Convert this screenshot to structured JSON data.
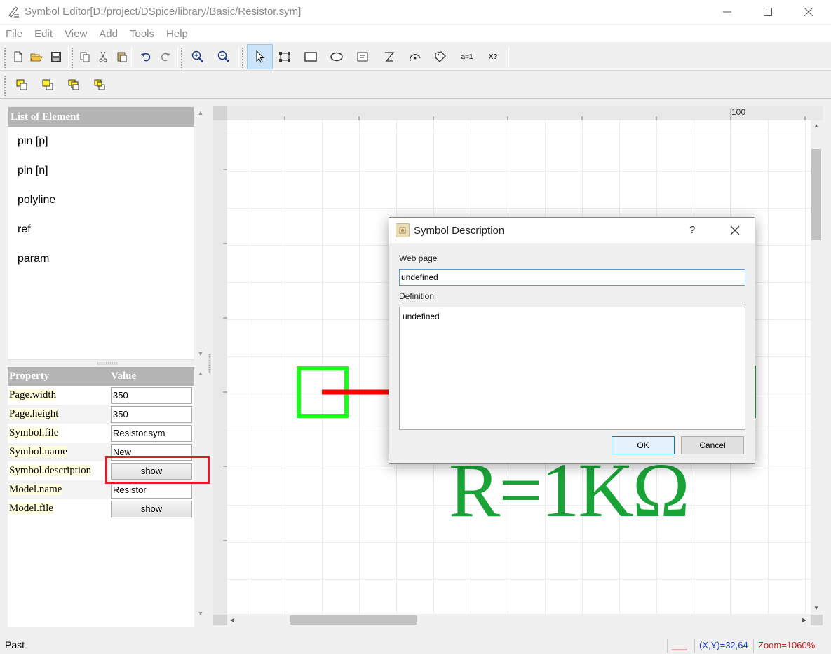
{
  "window": {
    "title": "Symbol Editor[D:/project/DSpice/library/Basic/Resistor.sym]"
  },
  "menu": [
    "File",
    "Edit",
    "View",
    "Add",
    "Tools",
    "Help"
  ],
  "toolbar": {
    "text_tool_1": "a=1",
    "text_tool_2": "X?"
  },
  "element_panel": {
    "header": "List of Element",
    "items": [
      "pin [p]",
      "pin [n]",
      "polyline",
      "ref",
      "param"
    ]
  },
  "property_panel": {
    "header_property": "Property",
    "header_value": "Value",
    "rows": [
      {
        "name": "Page.width",
        "value": "350",
        "type": "input"
      },
      {
        "name": "Page.height",
        "value": "350",
        "type": "input"
      },
      {
        "name": "Symbol.file",
        "value": "Resistor.sym",
        "type": "input"
      },
      {
        "name": "Symbol.name",
        "value": "New",
        "type": "input"
      },
      {
        "name": "Symbol.description",
        "value": "show",
        "type": "button"
      },
      {
        "name": "Model.name",
        "value": "Resistor",
        "type": "input"
      },
      {
        "name": "Model.file",
        "value": "show",
        "type": "button"
      }
    ]
  },
  "canvas": {
    "ruler_label": "100",
    "symbol_text": "R=1KΩ",
    "pin_color": "#1aff1a",
    "wire_color": "#ff0000",
    "text_color": "#1aa437"
  },
  "dialog": {
    "title": "Symbol Description",
    "help": "?",
    "web_label": "Web page",
    "web_value": "undefined",
    "definition_label": "Definition",
    "definition_value": "undefined",
    "ok_label": "OK",
    "cancel_label": "Cancel"
  },
  "status": {
    "message": "Past",
    "coords": "(X,Y)=32,64",
    "zoom": "Zoom=1060%",
    "line_sample": "___"
  },
  "colors": {
    "highlight_box": "#e21d2a",
    "status_coords": "#1a3fd0",
    "status_zoom": "#d01a1a"
  }
}
